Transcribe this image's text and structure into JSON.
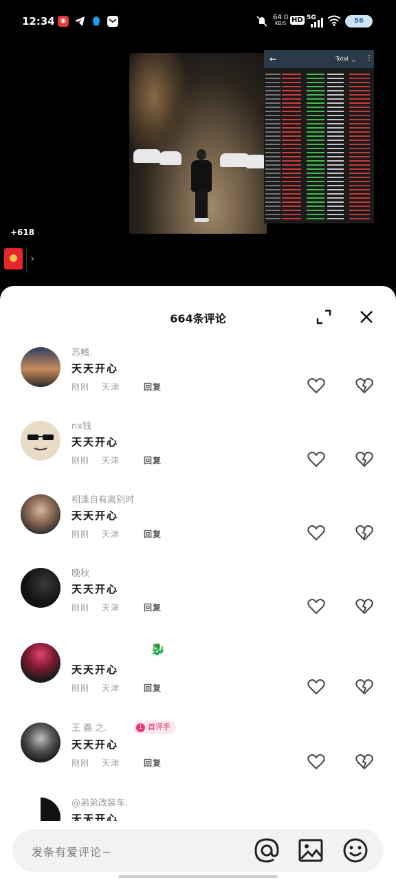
{
  "status_bar": {
    "time": "12:34",
    "net_speed_value": "64.0",
    "net_speed_unit": "KB/S",
    "hd_label": "HD",
    "signal_label": "5G",
    "battery": "56",
    "icons": [
      "netease-music-icon",
      "telegram-icon",
      "qq-icon",
      "mail-icon",
      "mute-icon",
      "signal-icon",
      "wifi-icon",
      "battery-icon"
    ]
  },
  "video": {
    "gift_count": "+618",
    "terminal_title": "Total"
  },
  "comments_sheet": {
    "title": "664条评论",
    "comments": [
      {
        "name": "苏鳍.",
        "text": "天天开心",
        "time": "刚刚",
        "location": "天津",
        "reply": "回复"
      },
      {
        "name": "nx钱",
        "text": "天天开心",
        "time": "刚刚",
        "location": "天津",
        "reply": "回复"
      },
      {
        "name": "相逢自有离别时",
        "text": "天天开心",
        "time": "刚刚",
        "location": "天津",
        "reply": "回复"
      },
      {
        "name": "晚秋",
        "text": "天天开心",
        "time": "刚刚",
        "location": "天津",
        "reply": "回复"
      },
      {
        "name": "",
        "text": "天天开心",
        "time": "刚刚",
        "location": "天津",
        "reply": "回复"
      },
      {
        "name": "王 義 之.",
        "badge": "首评手",
        "badge_num": "1",
        "text": "天天开心",
        "time": "刚刚",
        "location": "天津",
        "reply": "回复"
      },
      {
        "name": "@弟弟改装车.",
        "text": "天天开心"
      }
    ]
  },
  "input_bar": {
    "placeholder": "发条有爱评论~"
  },
  "colors": {
    "badge_pink": "#f0316a",
    "sheet_bg": "#ffffff",
    "envelope_red": "#e5262d"
  }
}
